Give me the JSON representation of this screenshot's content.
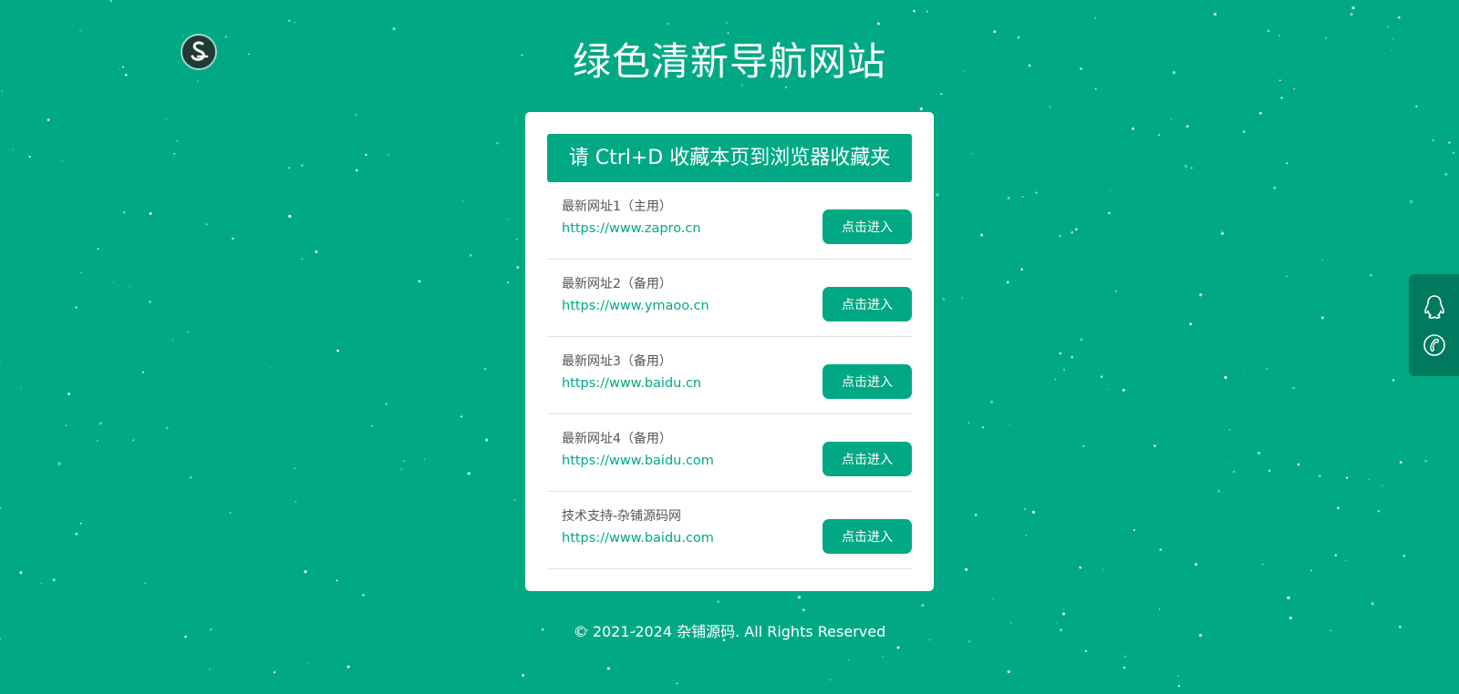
{
  "header": {
    "title": "绿色清新导航网站"
  },
  "card": {
    "bookmark_tip": "请 Ctrl+D 收藏本页到浏览器收藏夹",
    "links": [
      {
        "name": "最新网址1（主用）",
        "url": "https://www.zapro.cn",
        "button_label": "点击进入"
      },
      {
        "name": "最新网址2（备用）",
        "url": "https://www.ymaoo.cn",
        "button_label": "点击进入"
      },
      {
        "name": "最新网址3（备用）",
        "url": "https://www.baidu.cn",
        "button_label": "点击进入"
      },
      {
        "name": "最新网址4（备用）",
        "url": "https://www.baidu.com",
        "button_label": "点击进入"
      },
      {
        "name": "技术支持-杂铺源码网",
        "url": "https://www.baidu.com",
        "button_label": "点击进入"
      }
    ]
  },
  "footer": {
    "copyright": "© 2021-2024 杂铺源码. All Rights Reserved"
  },
  "side_panel": {
    "icons": [
      "qq-icon",
      "phone-icon"
    ]
  },
  "colors": {
    "brand": "#00a984",
    "side_panel": "#007a5f",
    "text": "#555555",
    "divider": "#e2e2e2"
  }
}
